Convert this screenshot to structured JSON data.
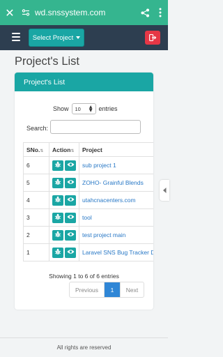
{
  "browser": {
    "url": "wd.snssystem.com",
    "close_icon": "close-icon",
    "site_icon": "site-settings-icon",
    "share_icon": "share-icon",
    "more_icon": "more-vert-icon",
    "color": "#35b58f"
  },
  "nav": {
    "menu_icon": "hamburger-icon",
    "select_project_label": "Select Project",
    "logout_icon": "logout-icon",
    "color": "#2d3e50",
    "accent": "#1aa6a4",
    "danger": "#e53746"
  },
  "page": {
    "title": "Project's List"
  },
  "card": {
    "header": "Project's List",
    "show_label": "Show",
    "show_value": "10",
    "entries_label": "entries",
    "search_label": "Search:",
    "search_value": "",
    "columns": [
      "SNo.",
      "Action",
      "Project"
    ],
    "rows": [
      {
        "sno": "6",
        "project": "sub project 1"
      },
      {
        "sno": "5",
        "project": "ZOHO- Grainful Blends"
      },
      {
        "sno": "4",
        "project": "utahcnacenters.com"
      },
      {
        "sno": "3",
        "project": "tool"
      },
      {
        "sno": "2",
        "project": "test project main"
      },
      {
        "sno": "1",
        "project": "Laravel SNS Bug Tracker Dev Pu"
      }
    ],
    "info": "Showing 1 to 6 of 6 entries",
    "pagination": {
      "prev": "Previous",
      "current": "1",
      "next": "Next"
    }
  },
  "footer": {
    "text": "All rights are reserved"
  }
}
